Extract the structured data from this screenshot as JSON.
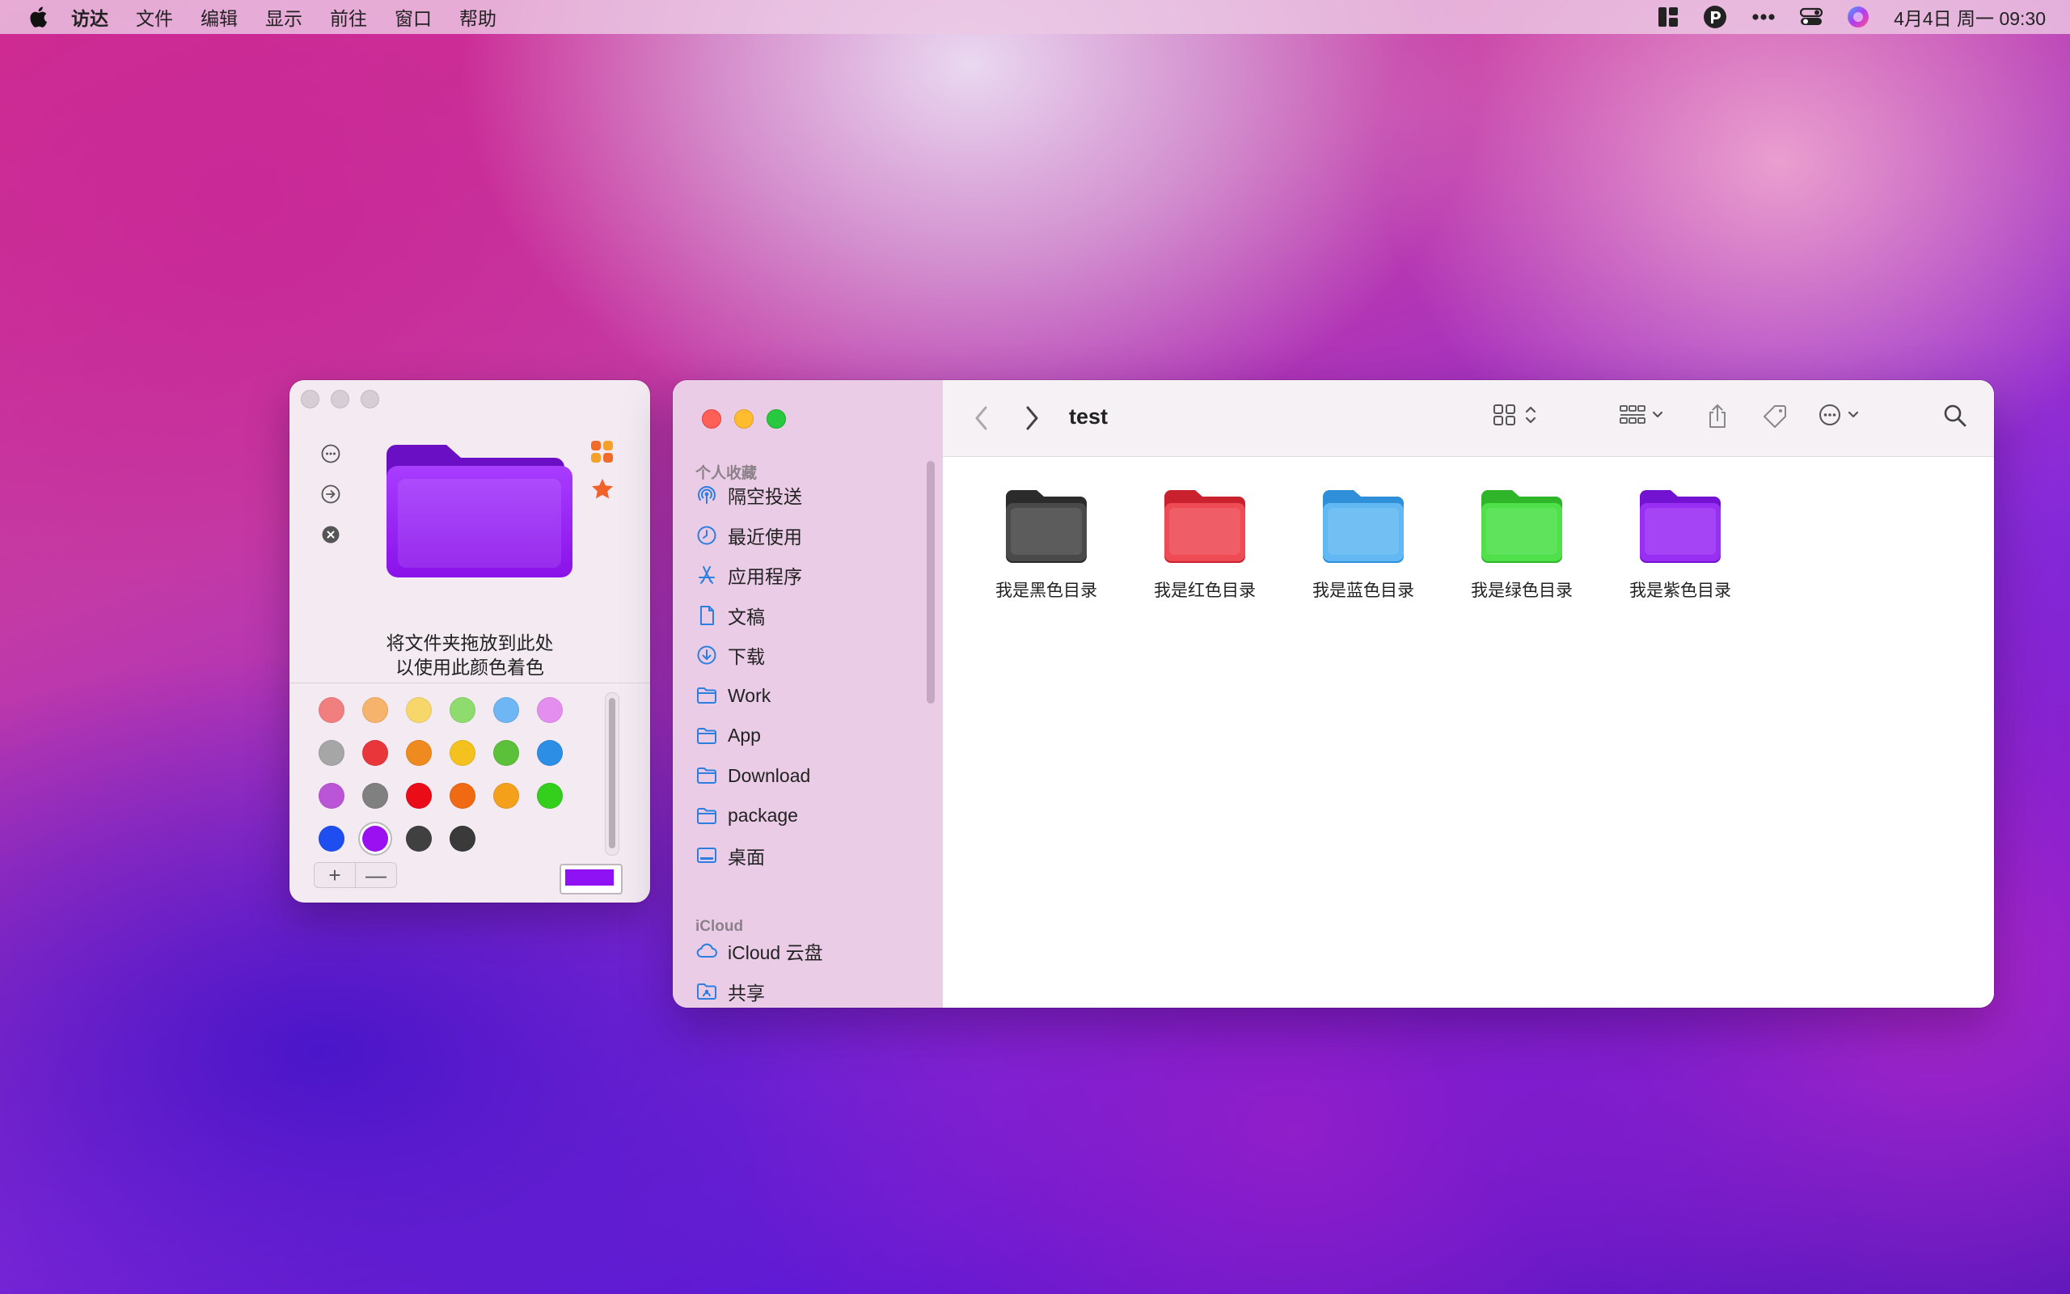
{
  "menubar": {
    "app_name": "访达",
    "items": [
      "文件",
      "编辑",
      "显示",
      "前往",
      "窗口",
      "帮助"
    ],
    "clock": "4月4日 周一  09:30"
  },
  "panel": {
    "caption_line1": "将文件夹拖放到此处",
    "caption_line2": "以使用此颜色着色",
    "folder_color": "#9a1ff7",
    "plus": "+",
    "minus": "—",
    "current_color": "#8f12f5",
    "swatches": [
      [
        "#f27f7f",
        "#f6b36b",
        "#f7d76a",
        "#8fdc6e",
        "#6fb6f4",
        "#e48ef0"
      ],
      [
        "#a6a6a6",
        "#e9363a",
        "#ef8a1f",
        "#f4c21e",
        "#5cc13a",
        "#2d8ee6"
      ],
      [
        "#bb55d8",
        "#808080",
        "#ea0d18",
        "#f06a14",
        "#f5a01a",
        "#34cf1d"
      ],
      [
        "#1f4ef0",
        "#9a10f0",
        "#404040",
        "#3a3a3a"
      ]
    ],
    "selected_swatch": "#9a10f0"
  },
  "finder": {
    "title": "test",
    "favorites_label": "个人收藏",
    "favorites": [
      {
        "label": "隔空投送",
        "icon": "airdrop-icon"
      },
      {
        "label": "最近使用",
        "icon": "clock-icon"
      },
      {
        "label": "应用程序",
        "icon": "applications-icon"
      },
      {
        "label": "文稿",
        "icon": "document-icon"
      },
      {
        "label": "下载",
        "icon": "download-icon"
      },
      {
        "label": "Work",
        "icon": "folder-icon"
      },
      {
        "label": "App",
        "icon": "folder-icon"
      },
      {
        "label": "Download",
        "icon": "folder-icon"
      },
      {
        "label": "package",
        "icon": "folder-icon"
      },
      {
        "label": "桌面",
        "icon": "desktop-icon"
      }
    ],
    "icloud_label": "iCloud",
    "icloud": [
      {
        "label": "iCloud 云盘",
        "icon": "cloud-icon"
      },
      {
        "label": "共享",
        "icon": "shared-folder-icon"
      }
    ],
    "files": [
      {
        "label": "我是黑色目录",
        "color": "#4a4a4a",
        "tab": "#2b2b2b"
      },
      {
        "label": "我是红色目录",
        "color": "#ee4b55",
        "tab": "#c9222e"
      },
      {
        "label": "我是蓝色目录",
        "color": "#62b8f2",
        "tab": "#2f8fd8"
      },
      {
        "label": "我是绿色目录",
        "color": "#4fe04a",
        "tab": "#2fb52a"
      },
      {
        "label": "我是紫色目录",
        "color": "#9a2ff4",
        "tab": "#7412d2"
      }
    ]
  }
}
